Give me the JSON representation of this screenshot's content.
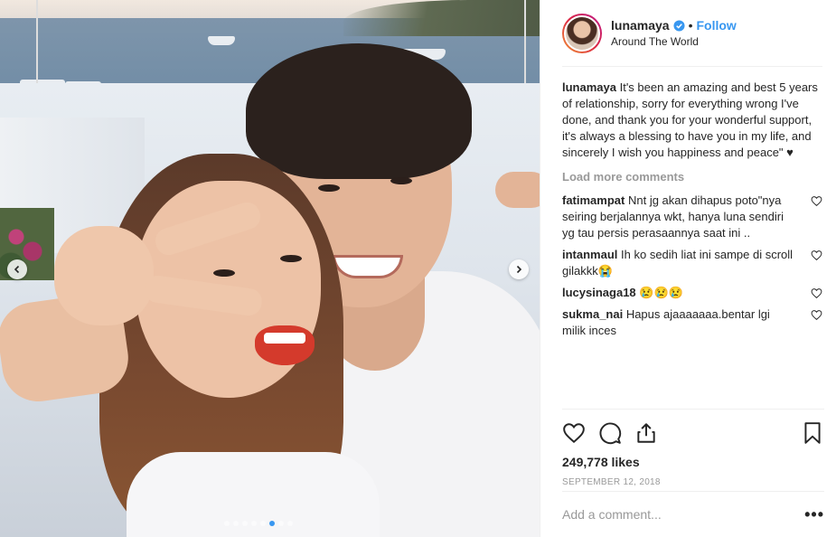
{
  "post": {
    "username": "lunamaya",
    "follow_label": "Follow",
    "separator": "•",
    "location": "Around The World",
    "caption_user": "lunamaya",
    "caption_text": " It's been an amazing and best 5 years of relationship, sorry for everything wrong I've done, and thank you for your wonderful support, it's always a blessing to have you in my life, and sincerely I wish you happiness and peace\" ♥",
    "load_more": "Load more comments",
    "likes": "249,778 likes",
    "date": "SEPTEMBER 12, 2018",
    "comment_placeholder": "Add a comment...",
    "more_label": "•••"
  },
  "comments": [
    {
      "user": "fatimampat",
      "text": " Nnt jg akan dihapus poto\"nya seiring berjalannya wkt, hanya luna sendiri yg tau persis perasaannya saat ini .."
    },
    {
      "user": "intanmaul",
      "text": " Ih ko sedih liat ini sampe di scroll gilakkk😭"
    },
    {
      "user": "lucysinaga18",
      "text": " 😢😢😢"
    },
    {
      "user": "sukma_nai",
      "text": " Hapus ajaaaaaaa.bentar lgi milik inces"
    }
  ],
  "carousel": {
    "total": 8,
    "active_index": 5
  },
  "colors": {
    "accent": "#3897f0",
    "muted": "#999999",
    "text": "#262626"
  },
  "icons": [
    "chevron-left-icon",
    "chevron-right-icon",
    "verified-badge-icon",
    "heart-icon",
    "comment-icon",
    "share-icon",
    "bookmark-icon"
  ]
}
